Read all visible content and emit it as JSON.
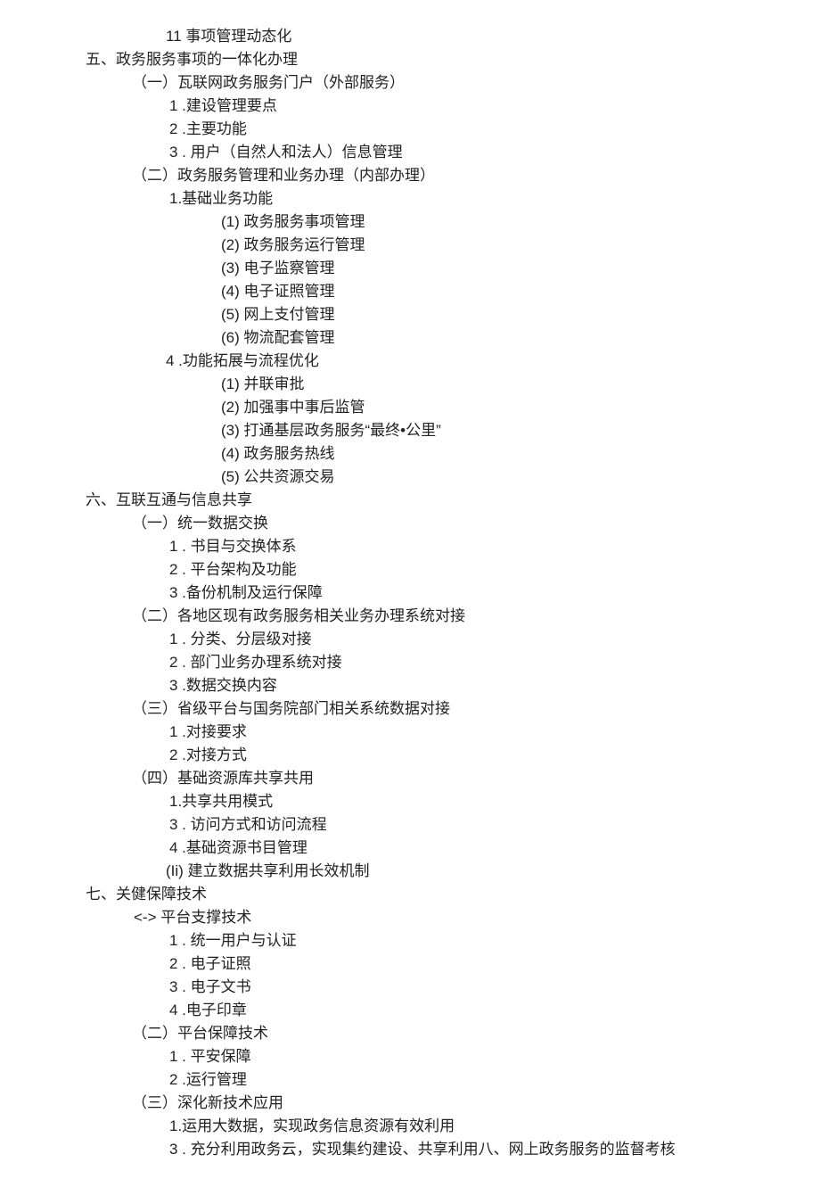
{
  "lines": [
    {
      "cls": "first11",
      "text": "11 事项管理动态化"
    },
    {
      "cls": "lv0",
      "text": "五、政务服务事项的一体化办理"
    },
    {
      "cls": "lv1",
      "text": "（一）瓦联网政务服务门户（外部服务）"
    },
    {
      "cls": "lv2",
      "text": "1 .建设管理要点"
    },
    {
      "cls": "lv2",
      "text": "2 .主要功能"
    },
    {
      "cls": "lv2",
      "text": "3 . 用户（自然人和法人）信息管理"
    },
    {
      "cls": "lv1",
      "text": "（二）政务服务管理和业务办理（内部办理）"
    },
    {
      "cls": "lv2",
      "text": "1.基础业务功能"
    },
    {
      "cls": "lv3",
      "text": "(1) 政务服务事项管理"
    },
    {
      "cls": "lv3",
      "text": "(2) 政务服务运行管理"
    },
    {
      "cls": "lv3",
      "text": "(3) 电子监察管理"
    },
    {
      "cls": "lv3",
      "text": "(4) 电子证照管理"
    },
    {
      "cls": "lv3",
      "text": "(5) 网上支付管理"
    },
    {
      "cls": "lv3",
      "text": "(6) 物流配套管理"
    },
    {
      "cls": "lv2b",
      "text": "4 .功能拓展与流程优化"
    },
    {
      "cls": "lv3",
      "text": "(1) 并联审批"
    },
    {
      "cls": "lv3",
      "text": "(2) 加强事中事后监管"
    },
    {
      "cls": "lv3",
      "text": "(3) 打通基层政务服务“最终•公里”"
    },
    {
      "cls": "lv3",
      "text": "(4) 政务服务热线"
    },
    {
      "cls": "lv3",
      "text": "(5) 公共资源交易"
    },
    {
      "cls": "lv0",
      "text": "六、互联互通与信息共享"
    },
    {
      "cls": "lv1",
      "text": "（一）统一数据交换"
    },
    {
      "cls": "lv2",
      "text": "1 . 书目与交换体系"
    },
    {
      "cls": "lv2",
      "text": "2 . 平台架构及功能"
    },
    {
      "cls": "lv2",
      "text": "3 .备份机制及运行保障"
    },
    {
      "cls": "lv1",
      "text": "（二）各地区现有政务服务相关业务办理系统对接"
    },
    {
      "cls": "lv2",
      "text": "1 . 分类、分层级对接"
    },
    {
      "cls": "lv2",
      "text": "2 . 部门业务办理系统对接"
    },
    {
      "cls": "lv2",
      "text": "3 .数据交换内容"
    },
    {
      "cls": "lv1",
      "text": "（三）省级平台与国务院部门相关系统数据对接"
    },
    {
      "cls": "lv2",
      "text": "1 .对接要求"
    },
    {
      "cls": "lv2",
      "text": "2 .对接方式"
    },
    {
      "cls": "lv1",
      "text": "（四）基础资源库共享共用"
    },
    {
      "cls": "lv2",
      "text": "1.共享共用模式"
    },
    {
      "cls": "lv2",
      "text": "3 . 访问方式和访问流程"
    },
    {
      "cls": "lv2",
      "text": "4 .基础资源书目管理"
    },
    {
      "cls": "lv2b",
      "text": "(Ii) 建立数据共享利用长效机制"
    },
    {
      "cls": "lv0",
      "text": "七、关健保障技术"
    },
    {
      "cls": "li-angle",
      "text": "<-> 平台支撑技术"
    },
    {
      "cls": "lv2",
      "text": "1 . 统一用户与认证"
    },
    {
      "cls": "lv2",
      "text": "2 . 电子证照"
    },
    {
      "cls": "lv2",
      "text": "3 . 电子文书"
    },
    {
      "cls": "lv2",
      "text": "4 .电子印章"
    },
    {
      "cls": "lv1",
      "text": "（二）平台保障技术"
    },
    {
      "cls": "lv2",
      "text": "1 . 平安保障"
    },
    {
      "cls": "lv2",
      "text": "2 .运行管理"
    },
    {
      "cls": "lv1",
      "text": "（三）深化新技术应用"
    },
    {
      "cls": "lv2",
      "text": "1.运用大数据，实现政务信息资源有效利用"
    },
    {
      "cls": "lv2",
      "text": "3 . 充分利用政务云，实现集约建设、共享利用八、网上政务服务的监督考核"
    }
  ]
}
